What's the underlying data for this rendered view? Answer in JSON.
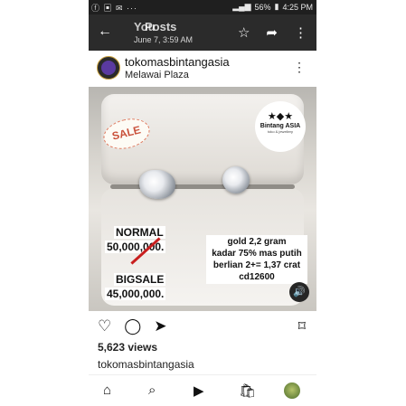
{
  "status_bar": {
    "left_icons": "ⓕ ▣ ✉ ···",
    "battery": "56%",
    "time": "4:25 PM"
  },
  "app_bar": {
    "title_a": "You",
    "title_b": "Posts",
    "date": "June 7, 3:59 AM",
    "icons": [
      "back-arrow-icon",
      "star-icon",
      "share-icon",
      "more-icon"
    ]
  },
  "post": {
    "username": "tokomasbintangasia",
    "location": "Melawai Plaza",
    "image": {
      "sale_sticker": "SALE",
      "logo_name": "Bintang ASIA",
      "logo_sub": "toko & jewellery",
      "normal_label": "NORMAL",
      "normal_price": "50,000,000.",
      "bigsale_label": "BIGSALE",
      "bigsale_price": "45,000,000.",
      "description": [
        "gold 2,2 gram",
        "kadar 75% mas putih",
        "berlian 2+= 1,37 crat",
        "cd12600"
      ]
    },
    "views": "5,623 views",
    "caption_user": "tokomasbintangasia"
  },
  "colors": {
    "app_bar_bg": "#2b2b2b",
    "status_bar_bg": "#1f1f1f",
    "strike_red": "#c81f1f"
  }
}
